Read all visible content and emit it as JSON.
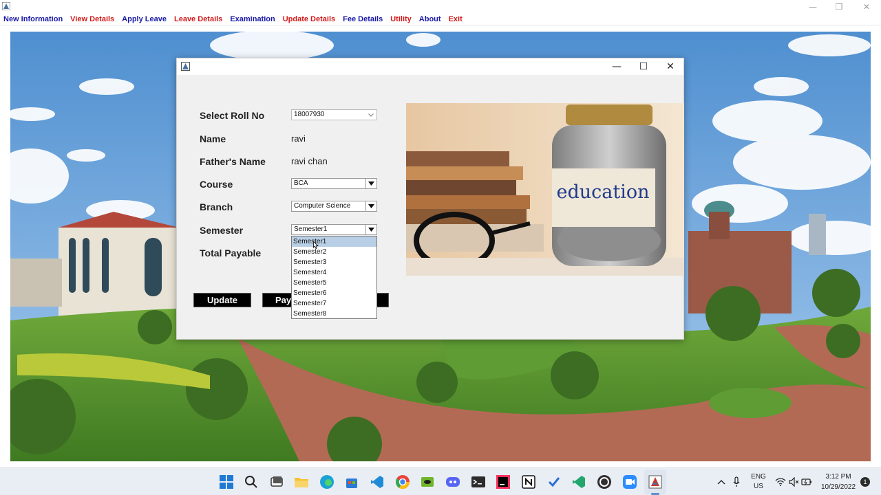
{
  "menubar": {
    "items": [
      {
        "label": "New Information",
        "color": "#1a1aa6"
      },
      {
        "label": "View Details",
        "color": "#d11a1a"
      },
      {
        "label": "Apply Leave",
        "color": "#1a1aa6"
      },
      {
        "label": "Leave Details",
        "color": "#d11a1a"
      },
      {
        "label": "Examination",
        "color": "#1a1aa6"
      },
      {
        "label": "Update Details",
        "color": "#d11a1a"
      },
      {
        "label": "Fee Details",
        "color": "#1a1aa6"
      },
      {
        "label": "Utility",
        "color": "#d11a1a"
      },
      {
        "label": "About",
        "color": "#1a1aa6"
      },
      {
        "label": "Exit",
        "color": "#d11a1a"
      }
    ]
  },
  "form": {
    "roll_label": "Select Roll No",
    "roll_value": "18007930",
    "name_label": "Name",
    "name_value": "ravi",
    "father_label": "Father's Name",
    "father_value": "ravi chan",
    "course_label": "Course",
    "course_value": "BCA",
    "branch_label": "Branch",
    "branch_value": "Computer Science",
    "semester_label": "Semester",
    "semester_value": "Semester1",
    "total_label": "Total Payable",
    "semester_options": [
      "Semester1",
      "Semester2",
      "Semester3",
      "Semester4",
      "Semester5",
      "Semester6",
      "Semester7",
      "Semester8"
    ]
  },
  "buttons": {
    "update": "Update",
    "pay": "Pay"
  },
  "picture": {
    "jar_label": "education"
  },
  "taskbar": {
    "apps": [
      "windows-start",
      "search",
      "task-view",
      "file-explorer",
      "edge",
      "store",
      "vscode",
      "chrome",
      "nvidia",
      "discord",
      "terminal",
      "intellij",
      "notion",
      "todo",
      "visual-studio",
      "obs",
      "zoom",
      "java-app"
    ],
    "language_line1": "ENG",
    "language_line2": "US",
    "time": "3:12 PM",
    "date": "10/29/2022",
    "notification_count": "1"
  },
  "colors": {
    "menu_blue": "#1a1aa6",
    "menu_red": "#d11a1a",
    "button_bg": "#000000",
    "dropdown_selected": "#b8cfe5"
  }
}
